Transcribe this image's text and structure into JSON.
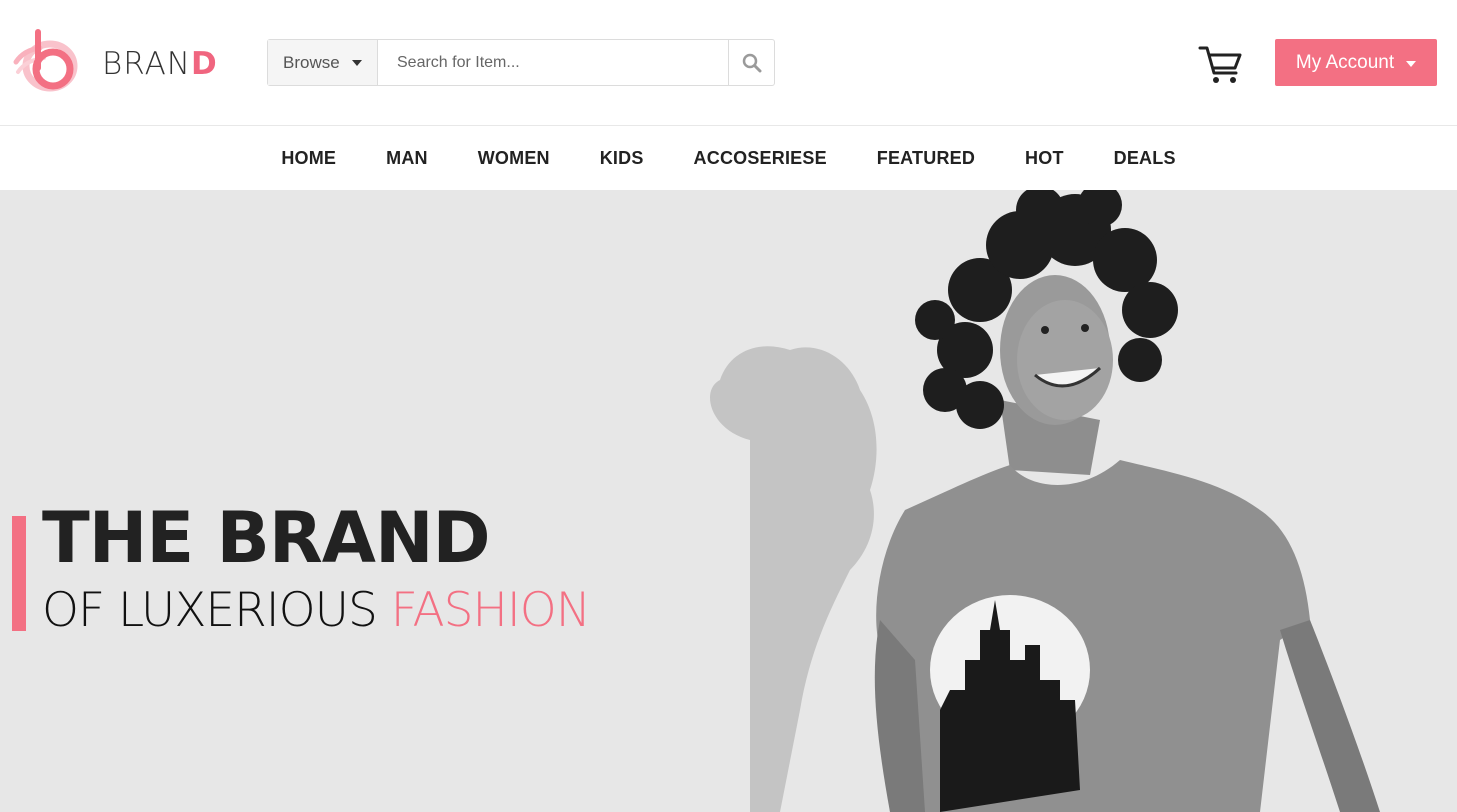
{
  "brand": {
    "name_main": "BRAN",
    "name_accent": "D",
    "accent_color": "#f37083"
  },
  "search": {
    "browse_label": "Browse",
    "placeholder": "Search for Item...",
    "value": ""
  },
  "account": {
    "label": "My Account"
  },
  "nav": {
    "items": [
      "HOME",
      "MAN",
      "WOMEN",
      "KIDS",
      "ACCOSERIESE",
      "FEATURED",
      "HOT",
      "DEALS"
    ]
  },
  "hero": {
    "title": "THE BRAND",
    "subtitle_main": "OF LUXERIOUS ",
    "subtitle_accent": "FASHION",
    "image": "smiling man in graphic t-shirt"
  },
  "icons": {
    "logo": "brand-logo-icon",
    "search": "search-icon",
    "cart": "shopping-cart-icon",
    "dropdown": "chevron-down-icon"
  }
}
